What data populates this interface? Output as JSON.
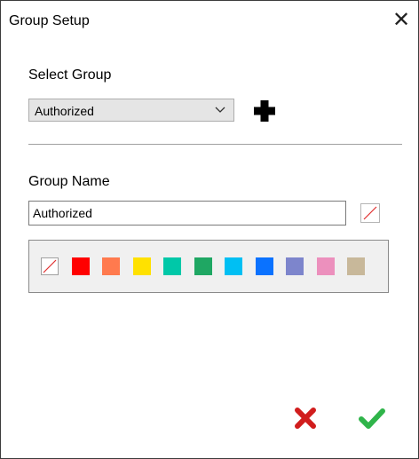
{
  "window": {
    "title": "Group Setup",
    "close_glyph": "✕"
  },
  "select_group": {
    "label": "Select Group",
    "selected": "Authorized",
    "chevron_icon": "chevron-down-icon",
    "add_icon": "plus-icon"
  },
  "group_name": {
    "label": "Group Name",
    "value": "Authorized",
    "current_color": "none"
  },
  "palette": {
    "colors": [
      "none",
      "#ff0000",
      "#ff7a4e",
      "#ffe100",
      "#00c8a8",
      "#1fa763",
      "#00bff3",
      "#0a72ff",
      "#7d85cc",
      "#ec90bd",
      "#c8b89a"
    ]
  },
  "actions": {
    "cancel_icon": "close-icon",
    "cancel_color": "#d11d1d",
    "confirm_icon": "check-icon",
    "confirm_color": "#2fb44a"
  }
}
